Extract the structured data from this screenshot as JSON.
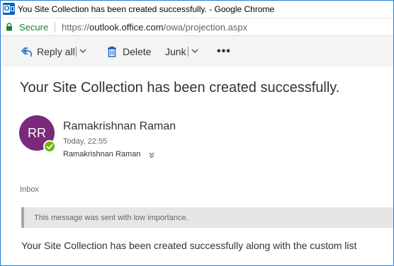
{
  "window": {
    "title": "You Site Collection has been created successfully. - Google Chrome"
  },
  "addressbar": {
    "secure_label": "Secure",
    "url_scheme": "https://",
    "url_host": "outlook.office.com",
    "url_path": "/owa/projection.aspx"
  },
  "toolbar": {
    "reply_all_label": "Reply all",
    "delete_label": "Delete",
    "junk_label": "Junk",
    "more_label": "•••"
  },
  "message": {
    "subject": "Your Site Collection has been created successfully.",
    "avatar_initials": "RR",
    "sender": "Ramakrishnan Raman",
    "timestamp": "Today, 22:55",
    "recipient": "Ramakrishnan Raman",
    "folder": "Inbox",
    "importance_notice": "This message was sent with low importance.",
    "body": "Your Site Collection has been created successfully along with the custom list"
  },
  "colors": {
    "avatar": "#7a2a7a",
    "presence": "#6bb700",
    "secure": "#188038",
    "toolbar_bg": "#f4f4f4"
  }
}
